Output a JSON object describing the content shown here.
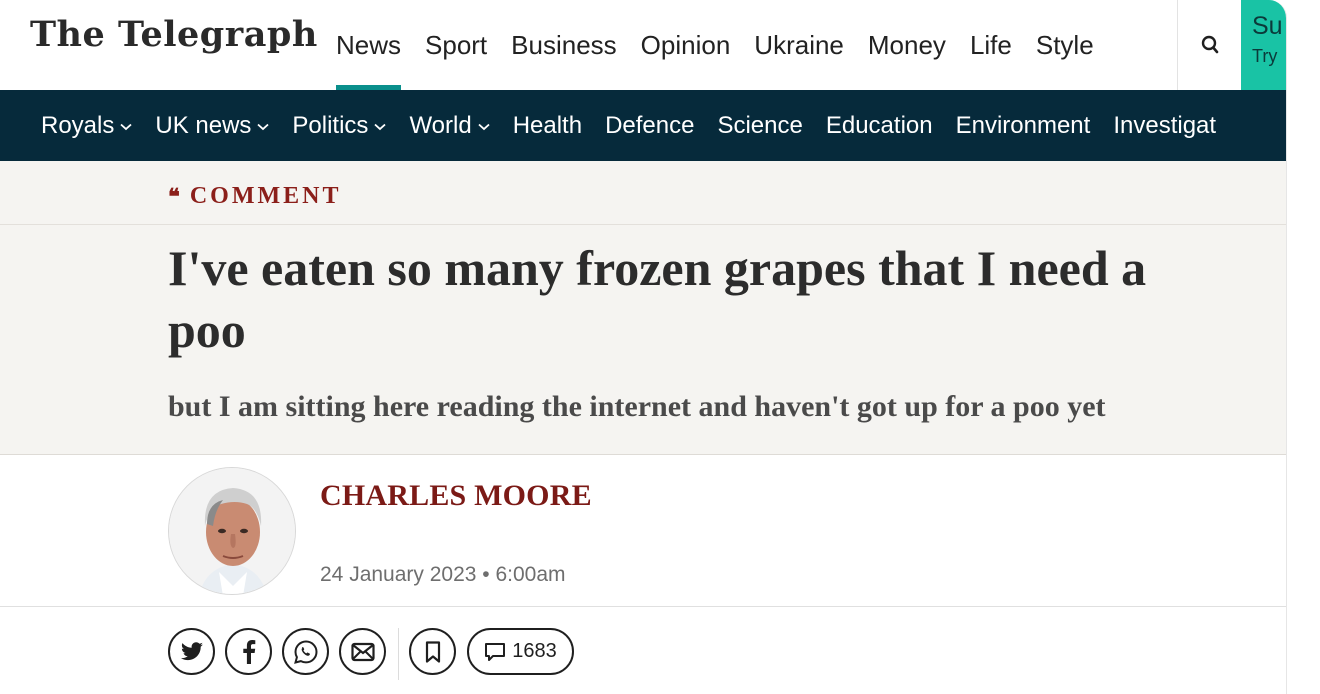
{
  "header": {
    "logo_text": "The Telegraph",
    "nav_items": [
      {
        "label": "News",
        "active": true
      },
      {
        "label": "Sport"
      },
      {
        "label": "Business"
      },
      {
        "label": "Opinion"
      },
      {
        "label": "Ukraine"
      },
      {
        "label": "Money"
      },
      {
        "label": "Life"
      },
      {
        "label": "Style"
      }
    ],
    "search_icon": "search-icon",
    "subscribe": {
      "line1": "Su",
      "line2": "Try"
    },
    "accent_color": "#0a8f8c",
    "subscribe_color": "#19c3a5"
  },
  "subnav": {
    "background": "#062a3b",
    "items": [
      {
        "label": "Royals",
        "dropdown": true
      },
      {
        "label": "UK news",
        "dropdown": true
      },
      {
        "label": "Politics",
        "dropdown": true
      },
      {
        "label": "World",
        "dropdown": true
      },
      {
        "label": "Health"
      },
      {
        "label": "Defence"
      },
      {
        "label": "Science"
      },
      {
        "label": "Education"
      },
      {
        "label": "Environment"
      },
      {
        "label": "Investigat"
      }
    ]
  },
  "article": {
    "kicker": "COMMENT",
    "kicker_icon": "quote-icon",
    "kicker_color": "#8b1f1a",
    "headline": "I've eaten so many frozen grapes that I need a poo",
    "standfirst": "but I am sitting here reading the internet and haven't got up for a poo yet",
    "author": "CHARLES MOORE",
    "author_color": "#7b1a16",
    "date": "24 January 2023 • 6:00am"
  },
  "share": {
    "buttons": [
      "twitter-icon",
      "facebook-icon",
      "whatsapp-icon",
      "email-icon",
      "bookmark-icon"
    ],
    "comments_count": "1683"
  }
}
